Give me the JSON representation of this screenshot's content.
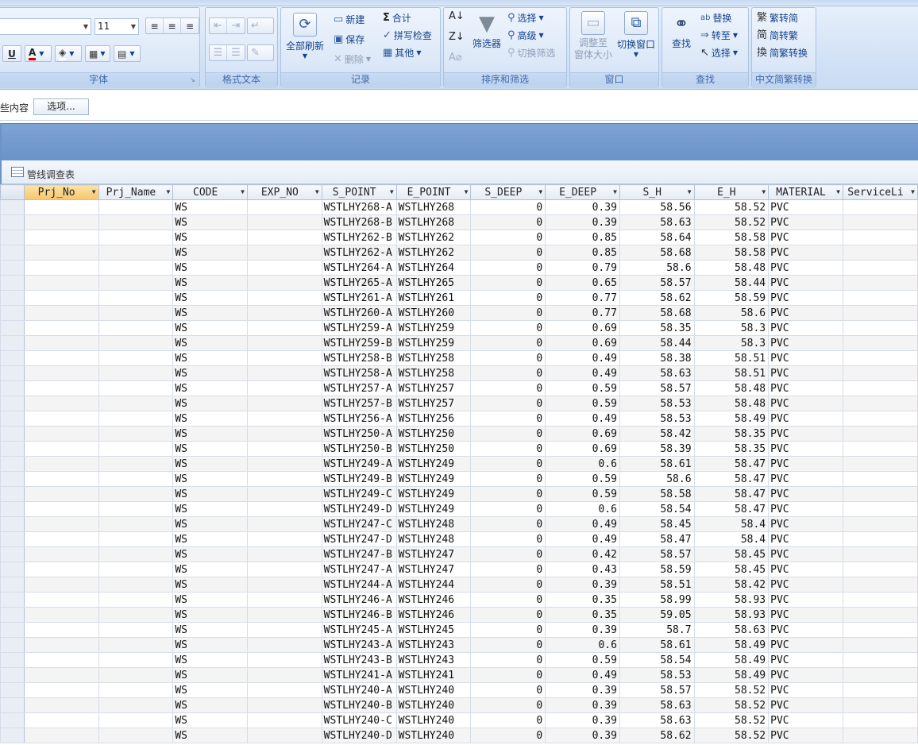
{
  "ribbon": {
    "font_group": {
      "label": "字体",
      "size_value": "11",
      "underline": "U",
      "font_color": "A"
    },
    "richtext_group": {
      "label": "格式文本"
    },
    "records_group": {
      "label": "记录",
      "refresh_all": "全部刷新",
      "new": "新建",
      "save": "保存",
      "delete": "删除",
      "totals": "合计",
      "spelling": "拼写检查",
      "more": "其他"
    },
    "sort_filter_group": {
      "label": "排序和筛选",
      "filter": "筛选器",
      "selection": "选择",
      "advanced": "高级",
      "toggle_filter": "切换筛选"
    },
    "window_group": {
      "label": "窗口",
      "size_to_fit": "调整至",
      "size_to_fit2": "窗体大小",
      "switch_windows": "切换窗口"
    },
    "find_group": {
      "label": "查找",
      "find": "查找",
      "replace": "替换",
      "goto": "转至",
      "select": "选择"
    },
    "chinese_group": {
      "label": "中文简繁转换",
      "t2s": "繁转简",
      "s2t": "简转繁",
      "convert": "简繁转换"
    }
  },
  "security_bar": {
    "text": "些内容",
    "options_button": "选项..."
  },
  "doc_tab": {
    "title": "管线调查表"
  },
  "table": {
    "columns": [
      "Prj_No",
      "Prj_Name",
      "CODE",
      "EXP_NO",
      "S_POINT",
      "E_POINT",
      "S_DEEP",
      "E_DEEP",
      "S_H",
      "E_H",
      "MATERIAL",
      "ServiceLi"
    ],
    "rows": [
      [
        "",
        "",
        "WS",
        "",
        "WSTLHY268-A",
        "WSTLHY268",
        "0",
        "0.39",
        "58.56",
        "58.52",
        "PVC",
        ""
      ],
      [
        "",
        "",
        "WS",
        "",
        "WSTLHY268-B",
        "WSTLHY268",
        "0",
        "0.39",
        "58.63",
        "58.52",
        "PVC",
        ""
      ],
      [
        "",
        "",
        "WS",
        "",
        "WSTLHY262-B",
        "WSTLHY262",
        "0",
        "0.85",
        "58.64",
        "58.58",
        "PVC",
        ""
      ],
      [
        "",
        "",
        "WS",
        "",
        "WSTLHY262-A",
        "WSTLHY262",
        "0",
        "0.85",
        "58.68",
        "58.58",
        "PVC",
        ""
      ],
      [
        "",
        "",
        "WS",
        "",
        "WSTLHY264-A",
        "WSTLHY264",
        "0",
        "0.79",
        "58.6",
        "58.48",
        "PVC",
        ""
      ],
      [
        "",
        "",
        "WS",
        "",
        "WSTLHY265-A",
        "WSTLHY265",
        "0",
        "0.65",
        "58.57",
        "58.44",
        "PVC",
        ""
      ],
      [
        "",
        "",
        "WS",
        "",
        "WSTLHY261-A",
        "WSTLHY261",
        "0",
        "0.77",
        "58.62",
        "58.59",
        "PVC",
        ""
      ],
      [
        "",
        "",
        "WS",
        "",
        "WSTLHY260-A",
        "WSTLHY260",
        "0",
        "0.77",
        "58.68",
        "58.6",
        "PVC",
        ""
      ],
      [
        "",
        "",
        "WS",
        "",
        "WSTLHY259-A",
        "WSTLHY259",
        "0",
        "0.69",
        "58.35",
        "58.3",
        "PVC",
        ""
      ],
      [
        "",
        "",
        "WS",
        "",
        "WSTLHY259-B",
        "WSTLHY259",
        "0",
        "0.69",
        "58.44",
        "58.3",
        "PVC",
        ""
      ],
      [
        "",
        "",
        "WS",
        "",
        "WSTLHY258-B",
        "WSTLHY258",
        "0",
        "0.49",
        "58.38",
        "58.51",
        "PVC",
        ""
      ],
      [
        "",
        "",
        "WS",
        "",
        "WSTLHY258-A",
        "WSTLHY258",
        "0",
        "0.49",
        "58.63",
        "58.51",
        "PVC",
        ""
      ],
      [
        "",
        "",
        "WS",
        "",
        "WSTLHY257-A",
        "WSTLHY257",
        "0",
        "0.59",
        "58.57",
        "58.48",
        "PVC",
        ""
      ],
      [
        "",
        "",
        "WS",
        "",
        "WSTLHY257-B",
        "WSTLHY257",
        "0",
        "0.59",
        "58.53",
        "58.48",
        "PVC",
        ""
      ],
      [
        "",
        "",
        "WS",
        "",
        "WSTLHY256-A",
        "WSTLHY256",
        "0",
        "0.49",
        "58.53",
        "58.49",
        "PVC",
        ""
      ],
      [
        "",
        "",
        "WS",
        "",
        "WSTLHY250-A",
        "WSTLHY250",
        "0",
        "0.69",
        "58.42",
        "58.35",
        "PVC",
        ""
      ],
      [
        "",
        "",
        "WS",
        "",
        "WSTLHY250-B",
        "WSTLHY250",
        "0",
        "0.69",
        "58.39",
        "58.35",
        "PVC",
        ""
      ],
      [
        "",
        "",
        "WS",
        "",
        "WSTLHY249-A",
        "WSTLHY249",
        "0",
        "0.6",
        "58.61",
        "58.47",
        "PVC",
        ""
      ],
      [
        "",
        "",
        "WS",
        "",
        "WSTLHY249-B",
        "WSTLHY249",
        "0",
        "0.59",
        "58.6",
        "58.47",
        "PVC",
        ""
      ],
      [
        "",
        "",
        "WS",
        "",
        "WSTLHY249-C",
        "WSTLHY249",
        "0",
        "0.59",
        "58.58",
        "58.47",
        "PVC",
        ""
      ],
      [
        "",
        "",
        "WS",
        "",
        "WSTLHY249-D",
        "WSTLHY249",
        "0",
        "0.6",
        "58.54",
        "58.47",
        "PVC",
        ""
      ],
      [
        "",
        "",
        "WS",
        "",
        "WSTLHY247-C",
        "WSTLHY248",
        "0",
        "0.49",
        "58.45",
        "58.4",
        "PVC",
        ""
      ],
      [
        "",
        "",
        "WS",
        "",
        "WSTLHY247-D",
        "WSTLHY248",
        "0",
        "0.49",
        "58.47",
        "58.4",
        "PVC",
        ""
      ],
      [
        "",
        "",
        "WS",
        "",
        "WSTLHY247-B",
        "WSTLHY247",
        "0",
        "0.42",
        "58.57",
        "58.45",
        "PVC",
        ""
      ],
      [
        "",
        "",
        "WS",
        "",
        "WSTLHY247-A",
        "WSTLHY247",
        "0",
        "0.43",
        "58.59",
        "58.45",
        "PVC",
        ""
      ],
      [
        "",
        "",
        "WS",
        "",
        "WSTLHY244-A",
        "WSTLHY244",
        "0",
        "0.39",
        "58.51",
        "58.42",
        "PVC",
        ""
      ],
      [
        "",
        "",
        "WS",
        "",
        "WSTLHY246-A",
        "WSTLHY246",
        "0",
        "0.35",
        "58.99",
        "58.93",
        "PVC",
        ""
      ],
      [
        "",
        "",
        "WS",
        "",
        "WSTLHY246-B",
        "WSTLHY246",
        "0",
        "0.35",
        "59.05",
        "58.93",
        "PVC",
        ""
      ],
      [
        "",
        "",
        "WS",
        "",
        "WSTLHY245-A",
        "WSTLHY245",
        "0",
        "0.39",
        "58.7",
        "58.63",
        "PVC",
        ""
      ],
      [
        "",
        "",
        "WS",
        "",
        "WSTLHY243-A",
        "WSTLHY243",
        "0",
        "0.6",
        "58.61",
        "58.49",
        "PVC",
        ""
      ],
      [
        "",
        "",
        "WS",
        "",
        "WSTLHY243-B",
        "WSTLHY243",
        "0",
        "0.59",
        "58.54",
        "58.49",
        "PVC",
        ""
      ],
      [
        "",
        "",
        "WS",
        "",
        "WSTLHY241-A",
        "WSTLHY241",
        "0",
        "0.49",
        "58.53",
        "58.49",
        "PVC",
        ""
      ],
      [
        "",
        "",
        "WS",
        "",
        "WSTLHY240-A",
        "WSTLHY240",
        "0",
        "0.39",
        "58.57",
        "58.52",
        "PVC",
        ""
      ],
      [
        "",
        "",
        "WS",
        "",
        "WSTLHY240-B",
        "WSTLHY240",
        "0",
        "0.39",
        "58.63",
        "58.52",
        "PVC",
        ""
      ],
      [
        "",
        "",
        "WS",
        "",
        "WSTLHY240-C",
        "WSTLHY240",
        "0",
        "0.39",
        "58.63",
        "58.52",
        "PVC",
        ""
      ],
      [
        "",
        "",
        "WS",
        "",
        "WSTLHY240-D",
        "WSTLHY240",
        "0",
        "0.39",
        "58.62",
        "58.52",
        "PVC",
        ""
      ]
    ]
  }
}
